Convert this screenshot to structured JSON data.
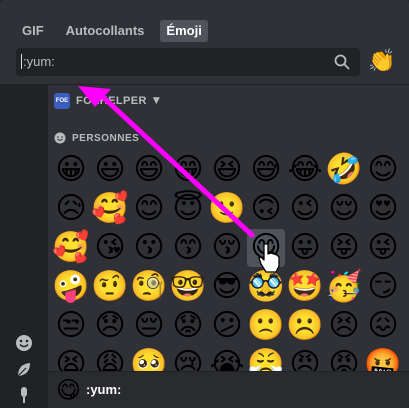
{
  "tabs": [
    {
      "label": "GIF",
      "active": false
    },
    {
      "label": "Autocollants",
      "active": false
    },
    {
      "label": "Émoji",
      "active": true
    }
  ],
  "search": {
    "value": ":yum:",
    "icon": "search-icon"
  },
  "random_emoji": "👏",
  "server": {
    "badge": "FOE",
    "label": "FOEHELPER"
  },
  "category": {
    "label": "PERSONNES"
  },
  "sidebar_icons": [
    "smiley-icon",
    "leaf-icon",
    "food-icon"
  ],
  "emojis": [
    [
      "😀",
      "😃",
      "😄",
      "😁",
      "😆",
      "😅",
      "😂",
      "🤣",
      "😊"
    ],
    [
      "😥",
      "🥰",
      "😊",
      "😇",
      "🙂",
      "🙃",
      "😉",
      "😌",
      "😍"
    ],
    [
      "🥰",
      "😘",
      "😗",
      "😙",
      "😚",
      "😋",
      "😛",
      "😝",
      "😜"
    ],
    [
      "🤪",
      "🤨",
      "🧐",
      "🤓",
      "😎",
      "🥸",
      "🤩",
      "🥳",
      "😏"
    ],
    [
      "😒",
      "😞",
      "😔",
      "😟",
      "😕",
      "🙁",
      "☹️",
      "😣",
      "😖"
    ],
    [
      "😫",
      "😩",
      "🥺",
      "😢",
      "😭",
      "😤",
      "😠",
      "😡",
      "🤬"
    ]
  ],
  "hovered": {
    "row": 2,
    "col": 5
  },
  "footer": {
    "emoji": "😋",
    "name": ":yum:"
  },
  "colors": {
    "arrow": "#ff00ff",
    "background": "#2f3136",
    "sidebar": "#202225"
  }
}
